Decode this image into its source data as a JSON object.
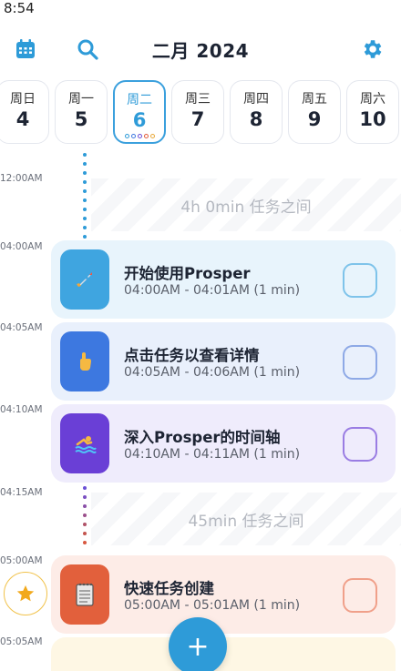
{
  "status": {
    "time": "8:54"
  },
  "header": {
    "title": "二月 2024"
  },
  "colors": {
    "accent": "#2e9bd8"
  },
  "days": [
    {
      "name": "周日",
      "date": "4",
      "active": false
    },
    {
      "name": "周一",
      "date": "5",
      "active": false
    },
    {
      "name": "周二",
      "date": "6",
      "active": true
    },
    {
      "name": "周三",
      "date": "7",
      "active": false
    },
    {
      "name": "周四",
      "date": "8",
      "active": false
    },
    {
      "name": "周五",
      "date": "9",
      "active": false
    },
    {
      "name": "周六",
      "date": "10",
      "active": false
    }
  ],
  "time_labels": [
    "12:00AM",
    "04:00AM",
    "04:05AM",
    "04:10AM",
    "04:15AM",
    "05:00AM",
    "05:05AM"
  ],
  "gaps": [
    {
      "text": "4h 0min 任务之间"
    },
    {
      "text": "45min 任务之间"
    }
  ],
  "tasks": [
    {
      "title": "开始使用Prosper",
      "time": "04:00AM - 04:01AM (1 min)",
      "icon": "rocket-icon"
    },
    {
      "title": "点击任务以查看详情",
      "time": "04:05AM - 04:06AM (1 min)",
      "icon": "pointing-hand-icon"
    },
    {
      "title": "深入Prosper的时间轴",
      "time": "04:10AM - 04:11AM (1 min)",
      "icon": "swimmer-icon"
    },
    {
      "title": "快速任务创建",
      "time": "05:00AM - 05:01AM (1 min)",
      "icon": "notepad-icon"
    }
  ],
  "fab": {
    "label": "+"
  }
}
